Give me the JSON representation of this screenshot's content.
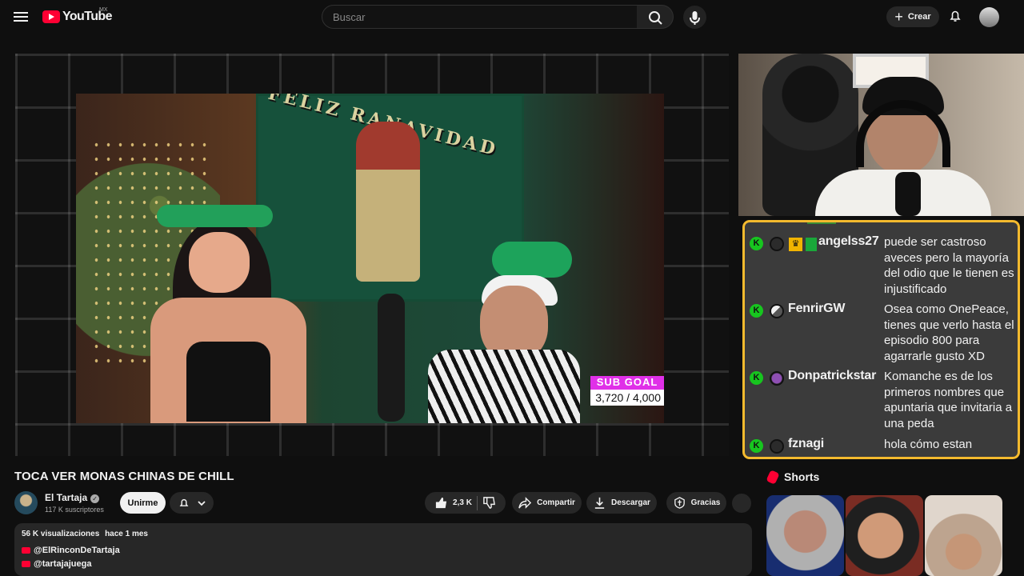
{
  "header": {
    "brand": "YouTube",
    "country": "MX",
    "search_placeholder": "Buscar",
    "create_label": "Crear"
  },
  "player": {
    "banner_text": "FELIZ RANAVIDAD",
    "goal_title": "SUB GOAL",
    "goal_value": "3,720  / 4,000"
  },
  "video": {
    "title": "TOCA VER MONAS CHINAS DE CHILL",
    "channel": "El Tartaja",
    "subscribers": "117 K suscriptores",
    "join_label": "Unirme",
    "like_count": "2,3 K",
    "share_label": "Compartir",
    "download_label": "Descargar",
    "thanks_label": "Gracias",
    "views": "56 K visualizaciones",
    "published": "hace 1 mes",
    "links": [
      "@ElRinconDeTartaja",
      "@tartajajuega"
    ]
  },
  "chat": [
    {
      "user": "angelss27",
      "message": "puede ser castroso aveces pero la mayoría del odio que le tienen es injustificado",
      "badges": [
        "k-icon",
        "user-icon",
        "crown-icon",
        "gift-icon"
      ]
    },
    {
      "user": "FenrirGW",
      "message": "Osea como OnePeace, tienes que verlo hasta el episodio 800 para agarrarle gusto XD",
      "badges": [
        "k-icon",
        "wolf-avatar-icon"
      ]
    },
    {
      "user": "Donpatrickstar",
      "message": "Komanche es de los primeros nombres que apuntaria que invitaria a una peda",
      "badges": [
        "k-icon",
        "avatar-icon"
      ]
    },
    {
      "user": "fznagi",
      "message": "hola cómo estan",
      "badges": [
        "k-icon",
        "user-icon"
      ]
    }
  ],
  "shorts": {
    "title": "Shorts"
  },
  "colors": {
    "background": "#0f0f0f",
    "youtube_red": "#ff0033",
    "chat_border": "#f4ba2e",
    "kick_green": "#17c51f",
    "goal_magenta": "#e030e8"
  }
}
